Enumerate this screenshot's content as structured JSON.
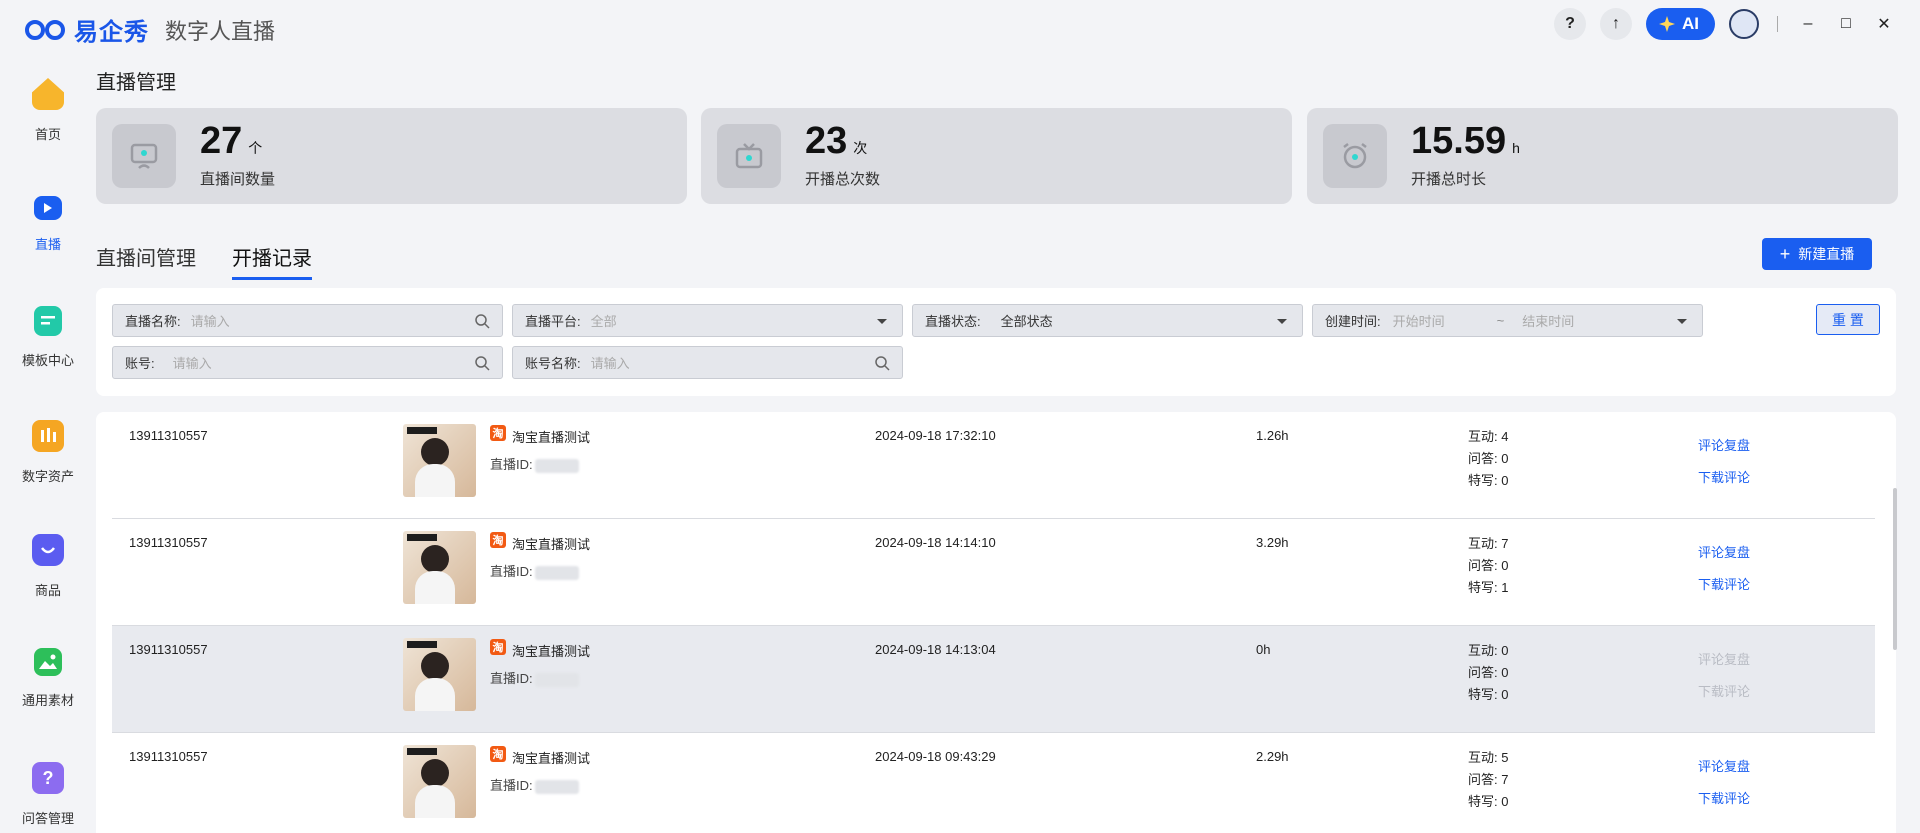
{
  "app": {
    "brand": "易企秀",
    "subtitle": "数字人直播"
  },
  "titlebar": {
    "help_icon": "?",
    "upload_icon": "↑",
    "ai_label": "AI",
    "minimize": "–",
    "maximize": "□",
    "close": "✕"
  },
  "sidebar": {
    "items": [
      {
        "label": "首页",
        "icon": "home-icon",
        "color": "#f7b52c"
      },
      {
        "label": "直播",
        "icon": "live-icon",
        "color": "#1a5ef0"
      },
      {
        "label": "模板中心",
        "icon": "template-icon",
        "color": "#22c9a8"
      },
      {
        "label": "数字资产",
        "icon": "asset-icon",
        "color": "#f5a623"
      },
      {
        "label": "商品",
        "icon": "bag-icon",
        "color": "#5b5cf0"
      },
      {
        "label": "通用素材",
        "icon": "image-icon",
        "color": "#2dbf5a"
      },
      {
        "label": "问答管理",
        "icon": "qa-icon",
        "color": "#8c6cf0"
      }
    ],
    "active_index": 1
  },
  "page": {
    "title": "直播管理"
  },
  "stats": [
    {
      "value": "27",
      "unit": "个",
      "label": "直播间数量",
      "icon": "monitor-icon"
    },
    {
      "value": "23",
      "unit": "次",
      "label": "开播总次数",
      "icon": "tv-icon"
    },
    {
      "value": "15.59",
      "unit": "h",
      "label": "开播总时长",
      "icon": "alarm-clock-icon"
    }
  ],
  "tabs": {
    "rooms": "直播间管理",
    "records": "开播记录"
  },
  "new_button": {
    "plus": "+",
    "label": "新建直播"
  },
  "filters": {
    "room_name_label": "直播名称:",
    "room_name_placeholder": "请输入",
    "platform_label": "直播平台:",
    "platform_value": "全部",
    "status_label": "直播状态:",
    "status_value": "全部状态",
    "created_label": "创建时间:",
    "start_placeholder": "开始时间",
    "tilde": "~",
    "end_placeholder": "结束时间",
    "account_label": "账号:",
    "account_placeholder": "请输入",
    "account_name_label": "账号名称:",
    "account_name_placeholder": "请输入",
    "reset_label": "重 置"
  },
  "records": [
    {
      "account": "13911310557",
      "name": "淘宝直播测试",
      "id_label": "直播ID:",
      "time": "2024-09-18 17:32:10",
      "duration": "1.26h",
      "interact": "互动: 4",
      "qa": "问答: 0",
      "special": "特写: 0",
      "review": "评论复盘",
      "download": "下载评论",
      "disabled": false
    },
    {
      "account": "13911310557",
      "name": "淘宝直播测试",
      "id_label": "直播ID:",
      "time": "2024-09-18 14:14:10",
      "duration": "3.29h",
      "interact": "互动: 7",
      "qa": "问答: 0",
      "special": "特写: 1",
      "review": "评论复盘",
      "download": "下载评论",
      "disabled": false
    },
    {
      "account": "13911310557",
      "name": "淘宝直播测试",
      "id_label": "直播ID:",
      "time": "2024-09-18 14:13:04",
      "duration": "0h",
      "interact": "互动: 0",
      "qa": "问答: 0",
      "special": "特写: 0",
      "review": "评论复盘",
      "download": "下载评论",
      "disabled": true
    },
    {
      "account": "13911310557",
      "name": "淘宝直播测试",
      "id_label": "直播ID:",
      "time": "2024-09-18 09:43:29",
      "duration": "2.29h",
      "interact": "互动: 5",
      "qa": "问答: 7",
      "special": "特写: 0",
      "review": "评论复盘",
      "download": "下载评论",
      "disabled": false
    }
  ],
  "platform_badge": "淘"
}
